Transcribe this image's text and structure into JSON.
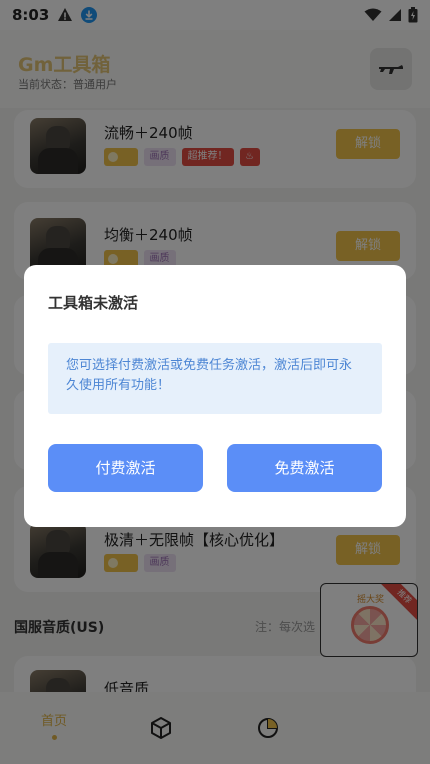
{
  "status_bar": {
    "time": "8:03"
  },
  "header": {
    "title": "Gm工具箱",
    "status": "当前状态：普通用户"
  },
  "modes": [
    {
      "title": "流畅＋240帧",
      "tags": [
        "画质",
        "超推荐！"
      ],
      "unlock": "解锁"
    },
    {
      "title": "均衡＋240帧",
      "tags": [
        "画质"
      ],
      "unlock": "解锁"
    },
    {
      "title": "极清＋无限帧【核心优化】",
      "tags": [
        "画质"
      ],
      "unlock": "解锁"
    },
    {
      "title": "低音质"
    }
  ],
  "section": {
    "title": "国服音质(US)",
    "note": "注：每次选"
  },
  "float_ad": {
    "label": "摇大奖",
    "ribbon": "推荐"
  },
  "tabbar": {
    "home": "首页"
  },
  "dialog": {
    "title": "工具箱未激活",
    "message": "您可选择付费激活或免费任务激活，激活后即可永久使用所有功能！",
    "paid_button": "付费激活",
    "free_button": "免费激活"
  },
  "colors": {
    "accent": "#f1c34a",
    "primary_button": "#5b8ef7",
    "message_bg": "#e6f0fb",
    "message_text": "#4d86d4"
  }
}
